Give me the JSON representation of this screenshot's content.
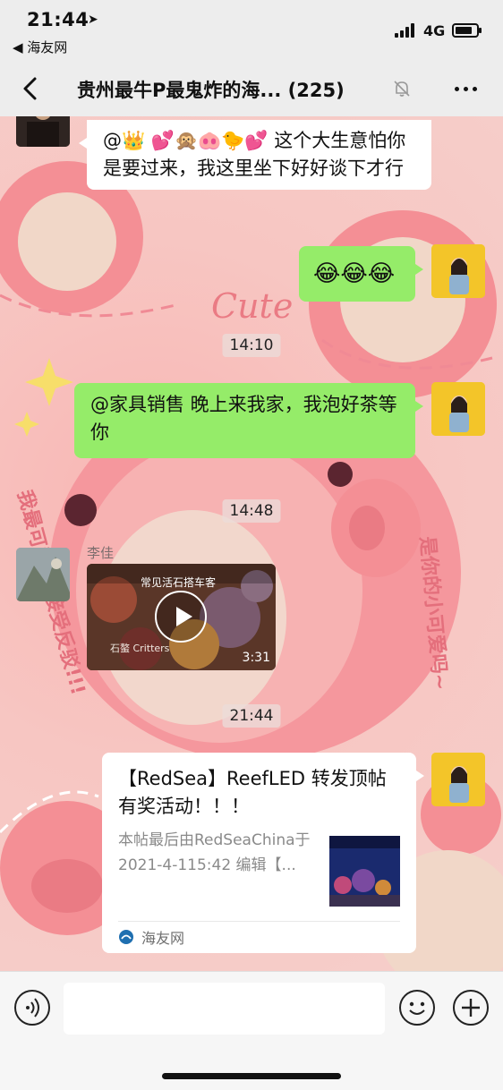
{
  "status_bar": {
    "time": "21:44",
    "location_arrow": "➤",
    "back_app": "◀ 海友网",
    "network": "4G",
    "signal_icon": "signal-bars-icon",
    "battery_level": 0.8
  },
  "nav": {
    "title": "贵州最牛P最鬼炸的海... (225)",
    "back_icon": "chevron-left-icon",
    "mute_icon": "bell-slash-icon",
    "more_icon": "ellipsis-icon"
  },
  "messages": [
    {
      "type": "text",
      "side": "left",
      "text": "@👑 💕🙊🐽🐤💕 这个大生意怕你是要过来，我这里坐下好好谈下才行"
    },
    {
      "type": "text",
      "side": "right",
      "text": "😂😂😂"
    },
    {
      "type": "time",
      "text": "14:10"
    },
    {
      "type": "text",
      "side": "right",
      "text": "@家具销售 晚上来我家，我泡好茶等你"
    },
    {
      "type": "time",
      "text": "14:48"
    },
    {
      "type": "video",
      "side": "left",
      "sender": "李佳",
      "video_title": "常见活石搭车客",
      "watermark": "石螯 Critters",
      "duration": "3:31"
    },
    {
      "type": "time",
      "text": "21:44"
    },
    {
      "type": "link",
      "side": "right",
      "title": "【RedSea】ReefLED 转发顶帖有奖活动！！！",
      "description": "本帖最后由RedSeaChina于 2021-4-115:42 编辑【...",
      "source": "海友网"
    }
  ],
  "input_bar": {
    "voice_icon": "voice-icon",
    "emoji_icon": "emoji-icon",
    "plus_icon": "plus-icon",
    "value": ""
  },
  "colors": {
    "bubble_green": "#95ec69",
    "bubble_white": "#ffffff",
    "bar_bg": "#ededed",
    "wallpaper_pink": "#f6c9c4"
  }
}
